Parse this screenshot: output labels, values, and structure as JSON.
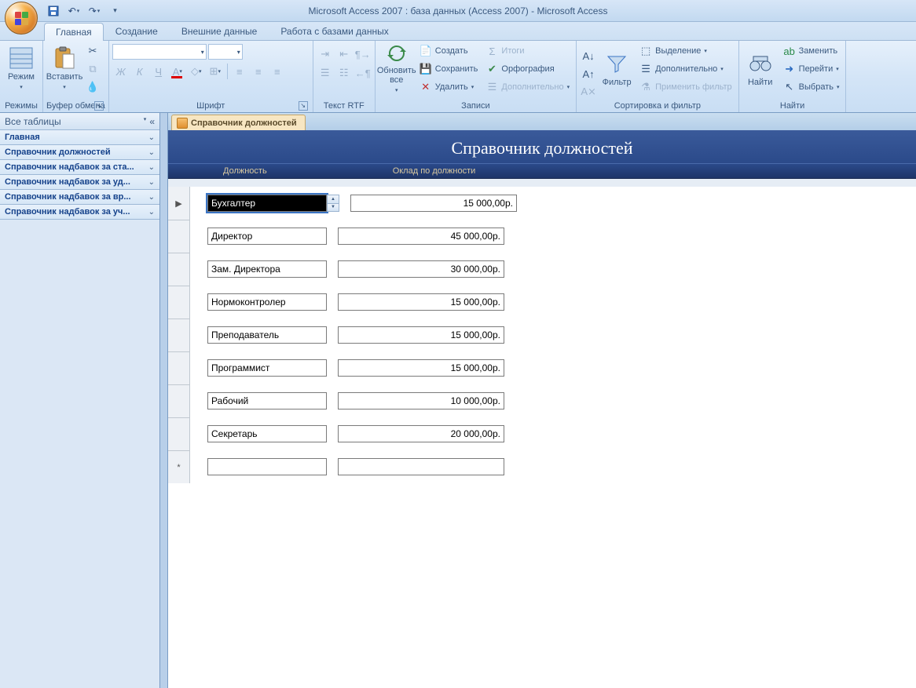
{
  "app": {
    "title": "Microsoft Access 2007 : база данных (Access 2007)  -  Microsoft Access"
  },
  "ribbon": {
    "tabs": [
      "Главная",
      "Создание",
      "Внешние данные",
      "Работа с базами данных"
    ],
    "active_tab": "Главная",
    "groups": {
      "modes": {
        "label": "Режимы",
        "btn": "Режим"
      },
      "clipboard": {
        "label": "Буфер обмена",
        "paste": "Вставить"
      },
      "font": {
        "label": "Шрифт"
      },
      "rtf": {
        "label": "Текст RTF"
      },
      "records": {
        "label": "Записи",
        "refresh": "Обновить все",
        "new": "Создать",
        "save": "Сохранить",
        "delete": "Удалить",
        "totals": "Итоги",
        "spelling": "Орфография",
        "more": "Дополнительно"
      },
      "sortfilter": {
        "label": "Сортировка и фильтр",
        "filter": "Фильтр",
        "selection": "Выделение",
        "advanced": "Дополнительно",
        "toggle": "Применить фильтр"
      },
      "find": {
        "label": "Найти",
        "find": "Найти",
        "replace": "Заменить",
        "goto": "Перейти",
        "select": "Выбрать"
      }
    }
  },
  "nav": {
    "header": "Все таблицы",
    "items": [
      "Главная",
      "Справочник должностей",
      "Справочник надбавок за ста...",
      "Справочник надбавок за уд...",
      "Справочник надбавок за вр...",
      "Справочник надбавок за уч..."
    ]
  },
  "doc": {
    "tab": "Справочник должностей",
    "title": "Справочник должностей",
    "col_position": "Должность",
    "col_salary": "Оклад по должности",
    "rows": [
      {
        "position": "Бухгалтер",
        "salary": "15 000,00р.",
        "selected": true,
        "active": true
      },
      {
        "position": "Директор",
        "salary": "45 000,00р."
      },
      {
        "position": "Зам. Директора",
        "salary": "30 000,00р."
      },
      {
        "position": "Нормоконтролер",
        "salary": "15 000,00р."
      },
      {
        "position": "Преподаватель",
        "salary": "15 000,00р."
      },
      {
        "position": "Программист",
        "salary": "15 000,00р."
      },
      {
        "position": "Рабочий",
        "salary": "10 000,00р."
      },
      {
        "position": "Секретарь",
        "salary": "20 000,00р."
      }
    ],
    "new_row_marker": "*"
  }
}
